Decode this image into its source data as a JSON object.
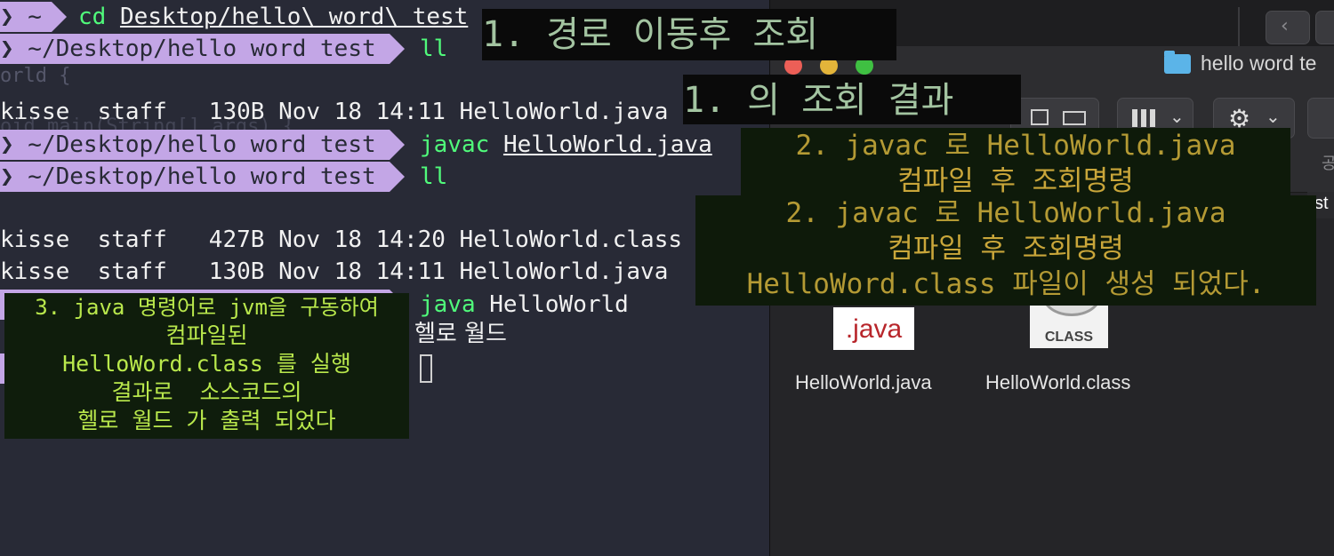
{
  "terminal": {
    "line1": {
      "prompt": "❯ ~ ",
      "cmd": "cd",
      "arg": "Desktop/hello\\ word\\ test"
    },
    "line2": {
      "prompt": "❯ ~/Desktop/hello word test ",
      "cmd": "ll"
    },
    "faded1": "orld {",
    "line3": "kisse  staff   130B Nov 18 14:11 HelloWorld.java",
    "faded2": "oid main(String[] args) {",
    "line4": {
      "prompt": "❯ ~/Desktop/hello word test ",
      "cmd": "javac",
      "arg": "HelloWorld.java"
    },
    "line5": {
      "prompt": "❯ ~/Desktop/hello word test ",
      "cmd": "ll"
    },
    "line6": "kisse  staff   427B Nov 18 14:20 HelloWorld.class",
    "line7": "kisse  staff   130B Nov 18 14:11 HelloWorld.java",
    "line8": {
      "cmd": "java",
      "arg": "HelloWorld"
    },
    "output": "헬로 월드"
  },
  "finder": {
    "title": "hello word te",
    "partial_label": "st",
    "partial_glyph": "공",
    "files": [
      {
        "name": "HelloWorld.java",
        "icon_text": ".java"
      },
      {
        "name": "HelloWorld.class",
        "icon_text": "CLASS"
      }
    ]
  },
  "annotations": {
    "step1": "1. 경로 이동후 조회",
    "step1_result": "1. 의 조회 결과",
    "step2a_line1": "2. javac 로 HelloWorld.java",
    "step2a_line2": "컴파일 후 조회명령",
    "step2b_line1": "2. javac 로 HelloWorld.java",
    "step2b_line2": "컴파일 후 조회명령",
    "step2b_line3": "HelloWord.class 파일이 생성 되었다.",
    "step3_line1": "3. java 명령어로 jvm을 구동하여",
    "step3_line2": "컴파일된",
    "step3_line3": "HelloWord.class 를 실행",
    "step3_line4": "결과로  소스코드의",
    "step3_line5": "헬로 월드 가 출력 되었다"
  }
}
